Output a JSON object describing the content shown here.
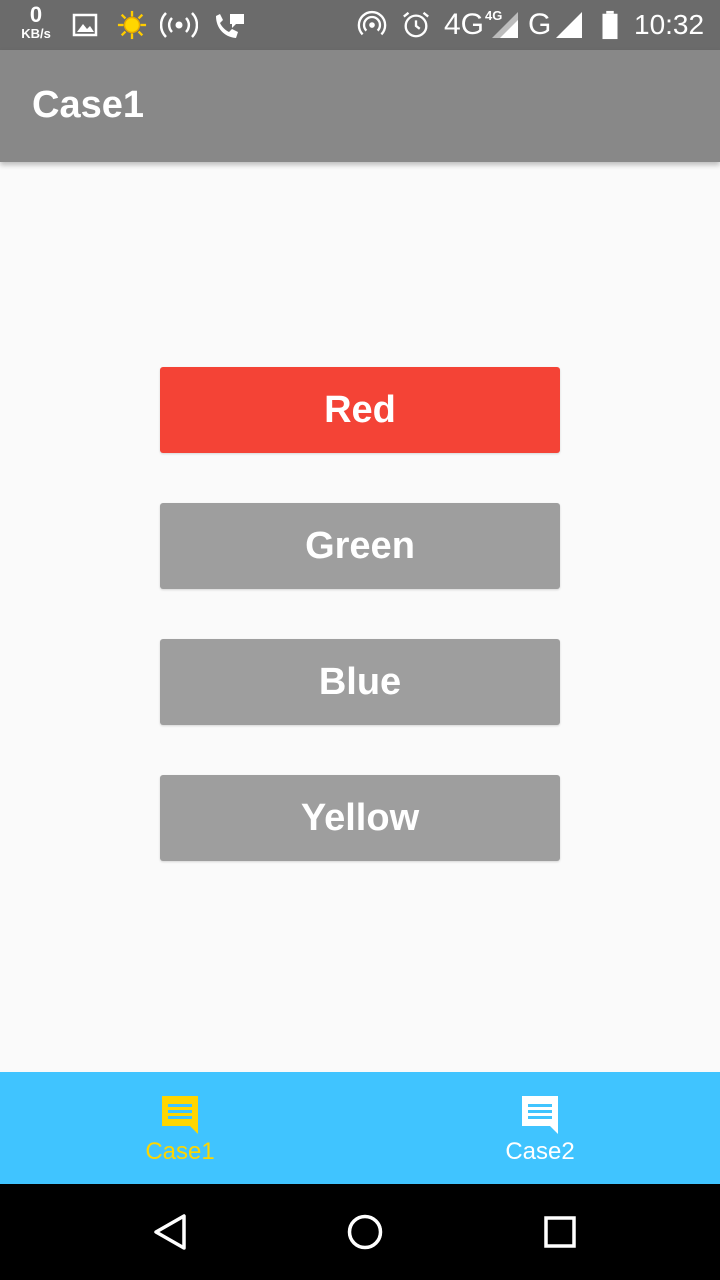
{
  "status_bar": {
    "speed_value": "0",
    "speed_unit": "KB/s",
    "network_1": "4G",
    "network_1_sup": "4G",
    "network_2": "G",
    "time": "10:32",
    "icons": [
      "gallery-icon",
      "weather-sun-icon",
      "hotspot-icon",
      "wifi-calling-icon",
      "portable-hotspot-icon",
      "alarm-icon",
      "signal-icon",
      "battery-icon"
    ]
  },
  "app_bar": {
    "title": "Case1"
  },
  "buttons": [
    {
      "label": "Red",
      "color": "#f44336",
      "selected": true
    },
    {
      "label": "Green",
      "color": "#9e9e9e",
      "selected": false
    },
    {
      "label": "Blue",
      "color": "#9e9e9e",
      "selected": false
    },
    {
      "label": "Yellow",
      "color": "#9e9e9e",
      "selected": false
    }
  ],
  "tab_bar": {
    "background": "#40c4ff",
    "active_color": "#ffd600",
    "inactive_color": "#ffffff",
    "tabs": [
      {
        "label": "Case1",
        "icon": "message-icon",
        "active": true
      },
      {
        "label": "Case2",
        "icon": "message-icon",
        "active": false
      }
    ]
  },
  "nav_bar": {
    "icons": [
      "back-icon",
      "home-icon",
      "recents-icon"
    ]
  }
}
